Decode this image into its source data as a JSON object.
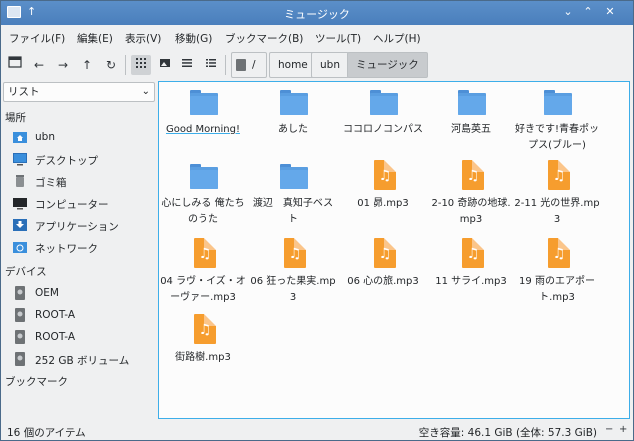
{
  "window": {
    "title": "ミュージック",
    "pin": "↑",
    "btn_minimize": "⌄",
    "btn_maximize": "⌃",
    "btn_close": "✕"
  },
  "menu": [
    "ファイル(F)",
    "編集(E)",
    "表示(V)",
    "移動(G)",
    "ブックマーク(B)",
    "ツール(T)",
    "ヘルプ(H)"
  ],
  "toolbar": {
    "icons": [
      "new-tab-icon",
      "back-icon",
      "forward-icon",
      "up-icon",
      "reload-icon",
      "icon-view-icon",
      "thumbnail-view-icon",
      "compact-view-icon",
      "detail-list-icon"
    ]
  },
  "breadcrumb": {
    "root": "/",
    "items": [
      "home",
      "ubn",
      "ミュージック"
    ]
  },
  "sidebar": {
    "view_mode": "リスト",
    "places_header": "場所",
    "places": [
      "ubn",
      "デスクトップ",
      "ゴミ箱",
      "コンピューター",
      "アプリケーション",
      "ネットワーク"
    ],
    "devices_header": "デバイス",
    "devices": [
      "OEM",
      "ROOT-A",
      "ROOT-A",
      "252 GB ボリューム"
    ],
    "bookmarks_header": "ブックマーク"
  },
  "files": [
    {
      "name": "Good Morning!",
      "type": "folder"
    },
    {
      "name": "あした",
      "type": "folder"
    },
    {
      "name": "ココロノコンパス",
      "type": "folder"
    },
    {
      "name": "河島英五",
      "type": "folder"
    },
    {
      "name": "好きです!青春ポップス(ブルー)",
      "type": "folder"
    },
    {
      "name": "心にしみる 俺たちのうた",
      "type": "folder"
    },
    {
      "name": "渡辺　真知子ベスト",
      "type": "folder"
    },
    {
      "name": "01 昴.mp3",
      "type": "audio"
    },
    {
      "name": "2-10 奇跡の地球.mp3",
      "type": "audio"
    },
    {
      "name": "2-11 光の世界.mp3",
      "type": "audio"
    },
    {
      "name": "04 ラヴ・イズ・オーヴァー.mp3",
      "type": "audio"
    },
    {
      "name": "06 狂った果実.mp3",
      "type": "audio"
    },
    {
      "name": "06 心の旅.mp3",
      "type": "audio"
    },
    {
      "name": "11 サライ.mp3",
      "type": "audio"
    },
    {
      "name": "19 雨のエアポート.mp3",
      "type": "audio"
    },
    {
      "name": "街路樹.mp3",
      "type": "audio"
    }
  ],
  "status": {
    "count": "16 個のアイテム",
    "free": "空き容量: 46.1 GiB (全体: 57.3 GiB)"
  },
  "colors": {
    "accent": "#3daee9",
    "titlebar": "#4a7fbc",
    "folder": "#5a9ee1",
    "audio": "#f69d2e"
  }
}
